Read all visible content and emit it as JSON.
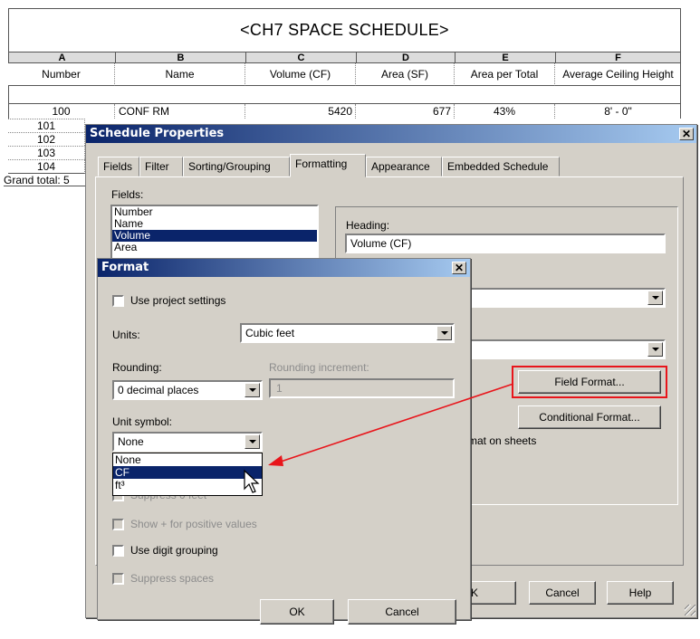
{
  "schedule": {
    "title": "<CH7 SPACE SCHEDULE>",
    "columns": [
      {
        "letter": "A",
        "name": "Number"
      },
      {
        "letter": "B",
        "name": "Name"
      },
      {
        "letter": "C",
        "name": "Volume (CF)"
      },
      {
        "letter": "D",
        "name": "Area (SF)"
      },
      {
        "letter": "E",
        "name": "Area per Total"
      },
      {
        "letter": "F",
        "name": "Average Ceiling Height"
      }
    ],
    "rows": [
      {
        "number": "100",
        "name": "CONF RM",
        "volume": "5420",
        "area": "677",
        "pct": "43%",
        "height": "8' - 0\""
      },
      {
        "number": "101"
      },
      {
        "number": "102"
      },
      {
        "number": "103"
      },
      {
        "number": "104"
      }
    ],
    "grand_total": "Grand total: 5"
  },
  "schedule_properties": {
    "title": "Schedule Properties",
    "tabs": [
      "Fields",
      "Filter",
      "Sorting/Grouping",
      "Formatting",
      "Appearance",
      "Embedded Schedule"
    ],
    "active_tab": "Formatting",
    "fields_label": "Fields:",
    "fields": [
      "Number",
      "Name",
      "Volume",
      "Area"
    ],
    "selected_field": "Volume",
    "heading_label": "Heading:",
    "heading_value": "Volume (CF)",
    "field_format_button": "Field Format...",
    "conditional_format_button": "Conditional Format...",
    "show_format_partial": "mat on sheets",
    "ok_partial": "K",
    "cancel_button": "Cancel",
    "help_button": "Help"
  },
  "format_dialog": {
    "title": "Format",
    "use_project_settings": "Use project settings",
    "units_label": "Units:",
    "units_value": "Cubic feet",
    "rounding_label": "Rounding:",
    "rounding_value": "0 decimal places",
    "rounding_increment_label": "Rounding increment:",
    "rounding_increment_value": "1",
    "unit_symbol_label": "Unit symbol:",
    "unit_symbol_value": "None",
    "unit_symbol_options": [
      "None",
      "CF",
      "ft³"
    ],
    "unit_symbol_highlighted": "CF",
    "suppress_feet": "Suppress 0 feet",
    "show_plus": "Show + for positive values",
    "digit_grouping": "Use digit grouping",
    "suppress_spaces": "Suppress spaces",
    "ok_button": "OK",
    "cancel_button": "Cancel"
  },
  "annotation": {
    "highlight_color": "#e8151b",
    "arrow_color": "#e8151b"
  }
}
